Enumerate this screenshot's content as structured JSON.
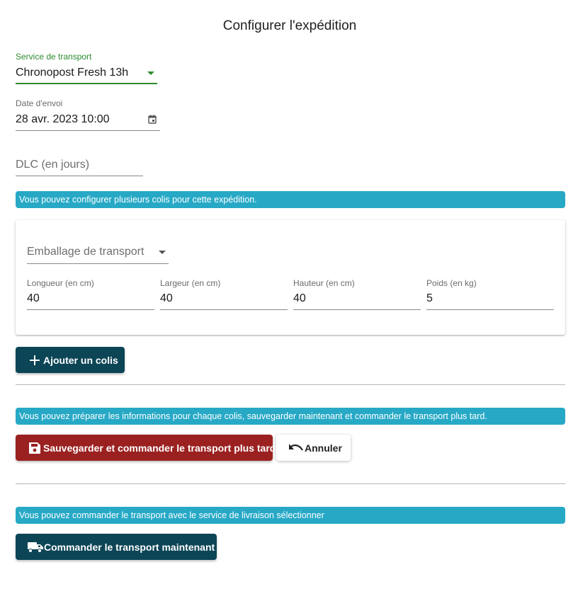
{
  "page": {
    "title": "Configurer l'expédition"
  },
  "transport_service": {
    "label": "Service de transport",
    "value": "Chronopost Fresh 13h"
  },
  "send_date": {
    "label": "Date d'envoi",
    "value": "28 avr. 2023 10:00"
  },
  "dlc": {
    "placeholder": "DLC (en jours)"
  },
  "info_packages": "Vous pouvez configurer plusieurs colis pour cette expédition.",
  "package": {
    "packaging": {
      "placeholder": "Emballage de transport"
    },
    "length": {
      "label": "Longueur (en cm)",
      "value": "40"
    },
    "width": {
      "label": "Largeur (en cm)",
      "value": "40"
    },
    "height": {
      "label": "Hauteur (en cm)",
      "value": "40"
    },
    "weight": {
      "label": "Poids (en kg)",
      "value": "5"
    }
  },
  "add_package_button": "Ajouter un colis",
  "info_save": "Vous pouvez préparer les informations pour chaque colis, sauvegarder maintenant et commander le transport plus tard.",
  "save_button": "Sauvegarder et commander le transport plus tard",
  "cancel_button": "Annuler",
  "info_order": "Vous pouvez commander le transport avec le service de livraison sélectionner",
  "order_button": "Commander le transport maintenant",
  "colors": {
    "accent_green": "#2e8b2e",
    "info_blue": "#27a9c6",
    "dark_button": "#0c4556",
    "red_button": "#9b2121"
  },
  "icons": {
    "select": "chevron-down-icon",
    "calendar": "calendar-icon",
    "add": "plus-icon",
    "save": "floppy-disk-icon",
    "cancel": "undo-icon",
    "order": "truck-icon"
  }
}
